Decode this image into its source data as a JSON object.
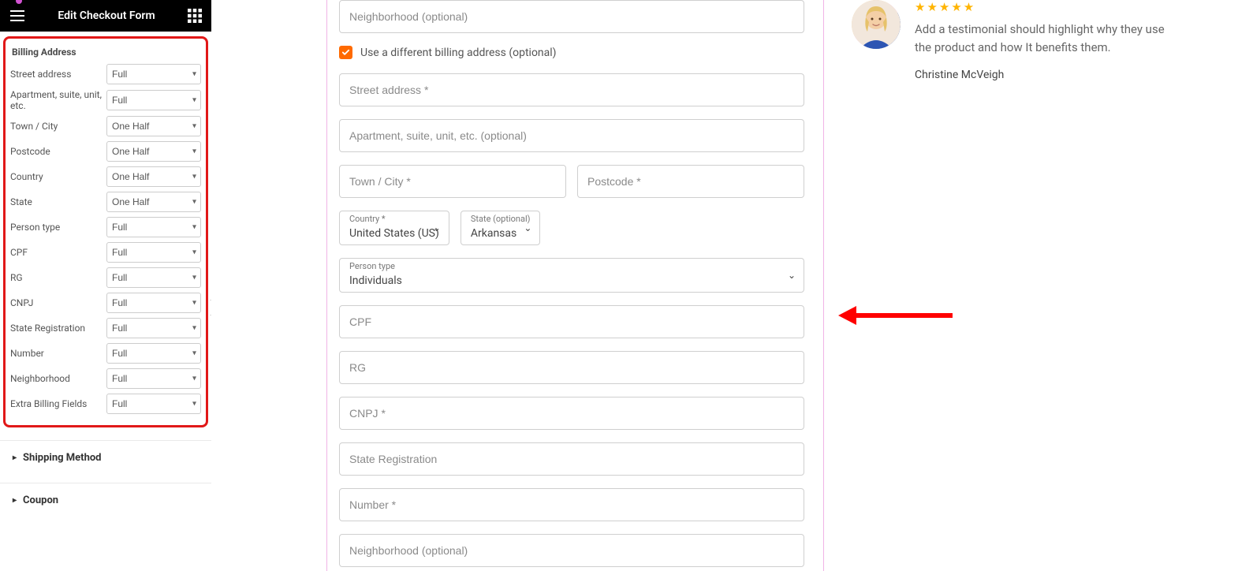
{
  "sidebar": {
    "title": "Edit Checkout Form",
    "billing_section_title": "Billing Address",
    "rows": [
      {
        "label": "Street address",
        "value": "Full"
      },
      {
        "label": "Apartment, suite, unit, etc.",
        "value": "Full"
      },
      {
        "label": "Town / City",
        "value": "One Half"
      },
      {
        "label": "Postcode",
        "value": "One Half"
      },
      {
        "label": "Country",
        "value": "One Half"
      },
      {
        "label": "State",
        "value": "One Half"
      },
      {
        "label": "Person type",
        "value": "Full"
      },
      {
        "label": "CPF",
        "value": "Full"
      },
      {
        "label": "RG",
        "value": "Full"
      },
      {
        "label": "CNPJ",
        "value": "Full"
      },
      {
        "label": "State Registration",
        "value": "Full"
      },
      {
        "label": "Number",
        "value": "Full"
      },
      {
        "label": "Neighborhood",
        "value": "Full"
      },
      {
        "label": "Extra Billing Fields",
        "value": "Full"
      }
    ],
    "sections": {
      "shipping": "Shipping Method",
      "coupon": "Coupon"
    }
  },
  "form": {
    "neighborhood_top_ph": "Neighborhood (optional)",
    "diff_billing": "Use a different billing address (optional)",
    "street_ph": "Street address *",
    "apt_ph": "Apartment, suite, unit, etc. (optional)",
    "town_ph": "Town / City *",
    "postcode_ph": "Postcode *",
    "country_label": "Country *",
    "country_value": "United States (US)",
    "state_label": "State (optional)",
    "state_value": "Arkansas",
    "person_label": "Person type",
    "person_value": "Individuals",
    "cpf_ph": "CPF",
    "rg_ph": "RG",
    "cnpj_ph": "CNPJ *",
    "statereg_ph": "State Registration",
    "number_ph": "Number *",
    "neighborhood_ph": "Neighborhood (optional)"
  },
  "testimonial": {
    "stars": "★★★★★",
    "text": "Add a testimonial should highlight why they use the product and how It benefits them.",
    "name": "Christine McVeigh"
  }
}
